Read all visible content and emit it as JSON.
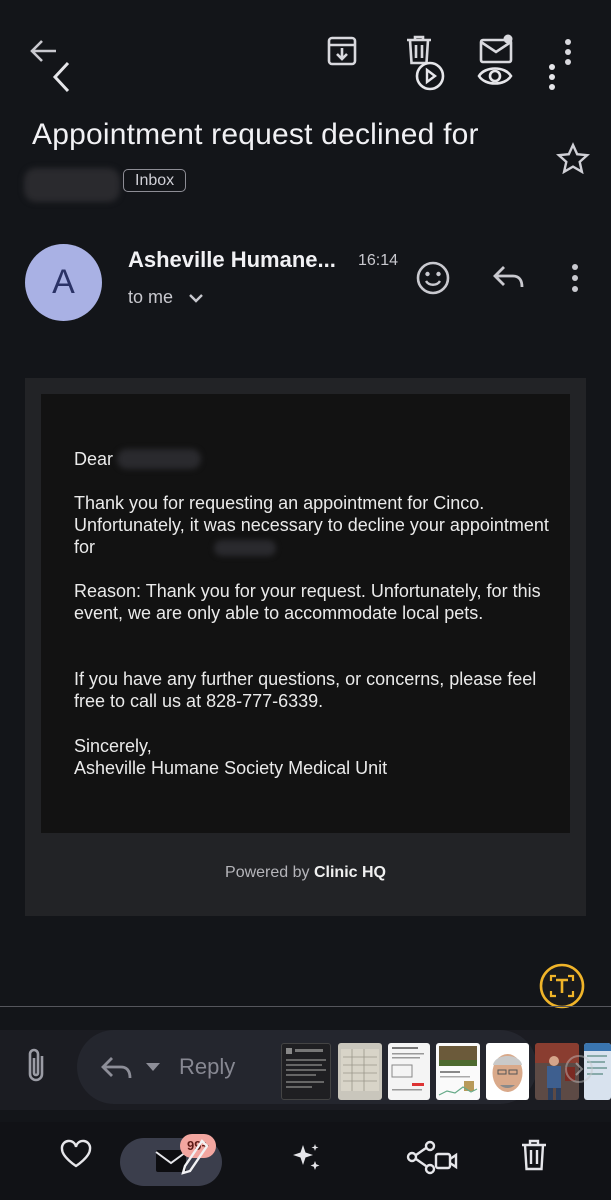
{
  "header": {
    "subject": "Appointment request declined for",
    "label_chip": "Inbox"
  },
  "message": {
    "avatar_letter": "A",
    "sender": "Asheville Humane...",
    "time": "16:14",
    "recipient": "to me"
  },
  "email_body": {
    "greeting": "Dear",
    "para1": "Thank you for requesting an appointment for Cinco. Unfortunately, it was necessary to decline your appointment for",
    "para2": "Reason: Thank you for your request. Unfortunately, for this event, we are only able to accommodate local pets.",
    "para3": "If you have any further questions, or concerns, please feel free to call us at 828-777-6339.",
    "closing": "Sincerely,",
    "signature": "Asheville Humane Society Medical Unit",
    "powered_prefix": "Powered by",
    "powered_brand": "Clinic HQ"
  },
  "compose": {
    "reply_label": "Reply"
  },
  "bottom_nav": {
    "badge": "99+"
  },
  "icons": {
    "back": "arrow-left-icon",
    "archive": "archive-icon",
    "delete": "trash-icon",
    "mark_unread": "mail-unread-icon",
    "more": "more-vert-icon",
    "star": "star-icon",
    "emoji": "emoji-icon",
    "reply": "reply-icon",
    "attach": "paperclip-icon",
    "text_scan": "text-scan-icon",
    "heart": "heart-icon",
    "edit": "pencil-icon",
    "sparkle": "sparkle-icon",
    "share": "share-icon",
    "trash_bottom": "trash-icon"
  },
  "colors": {
    "avatar_bg": "#a9b1e4",
    "text_scan_accent": "#f0b429",
    "badge_bg": "#f2a6a0"
  }
}
